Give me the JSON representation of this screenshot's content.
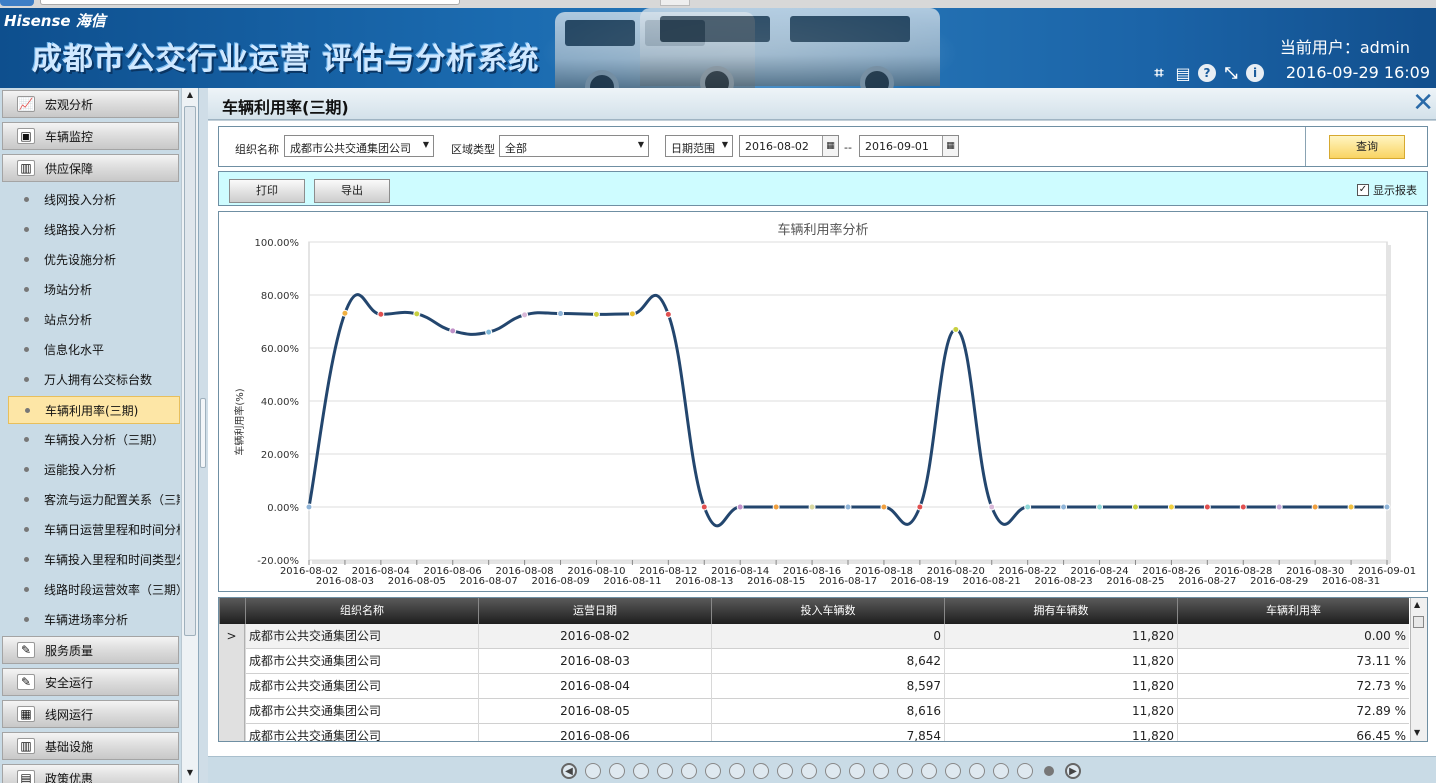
{
  "header": {
    "logo": "Hisense 海信",
    "system_name": "成都市公交行业运营 评估与分析系统",
    "current_user_label": "当前用户：admin",
    "datetime": "2016-09-29 16:09",
    "icons": [
      "crop-icon",
      "screen-icon",
      "help-icon",
      "restore-icon",
      "info-icon"
    ]
  },
  "sidebar": {
    "groups_top": [
      {
        "label": "宏观分析",
        "icon": "chart-icon"
      },
      {
        "label": "车辆监控",
        "icon": "monitor-icon"
      },
      {
        "label": "供应保障",
        "icon": "supply-icon"
      }
    ],
    "items": [
      "线网投入分析",
      "线路投入分析",
      "优先设施分析",
      "场站分析",
      "站点分析",
      "信息化水平",
      "万人拥有公交标台数",
      "车辆利用率(三期)",
      "车辆投入分析（三期）",
      "运能投入分析",
      "客流与运力配置关系（三期）",
      "车辆日运营里程和时间分析",
      "车辆投入里程和时间类型分析",
      "线路时段运营效率（三期）",
      "车辆进场率分析"
    ],
    "active_index": 7,
    "groups_bottom": [
      {
        "label": "服务质量",
        "icon": "quality-icon"
      },
      {
        "label": "安全运行",
        "icon": "safety-icon"
      },
      {
        "label": "线网运行",
        "icon": "network-icon"
      },
      {
        "label": "基础设施",
        "icon": "infrastructure-icon"
      },
      {
        "label": "政策优惠",
        "icon": "policy-icon"
      }
    ]
  },
  "page": {
    "title": "车辆利用率(三期)",
    "close_glyph": "✕"
  },
  "query": {
    "org_label": "组织名称",
    "org_value": "成都市公共交通集团公司",
    "area_label": "区域类型",
    "area_value": "全部",
    "date_mode": "日期范围",
    "date_from": "2016-08-02",
    "date_sep": "--",
    "date_to": "2016-09-01",
    "query_button": "查询"
  },
  "toolbar": {
    "print_button": "打印",
    "export_button": "导出",
    "show_report_label": "显示报表",
    "show_report_checked": true
  },
  "chart_data": {
    "type": "line",
    "title": "车辆利用率分析",
    "ylabel": "车辆利用率(%)",
    "ylim": [
      -20,
      100
    ],
    "yticks": [
      "-20.00%",
      "0.00%",
      "20.00%",
      "40.00%",
      "60.00%",
      "80.00%",
      "100.00%"
    ],
    "x": [
      "2016-08-02",
      "2016-08-03",
      "2016-08-04",
      "2016-08-05",
      "2016-08-06",
      "2016-08-07",
      "2016-08-08",
      "2016-08-09",
      "2016-08-10",
      "2016-08-11",
      "2016-08-12",
      "2016-08-13",
      "2016-08-14",
      "2016-08-15",
      "2016-08-16",
      "2016-08-17",
      "2016-08-18",
      "2016-08-19",
      "2016-08-20",
      "2016-08-21",
      "2016-08-22",
      "2016-08-23",
      "2016-08-24",
      "2016-08-25",
      "2016-08-26",
      "2016-08-27",
      "2016-08-28",
      "2016-08-29",
      "2016-08-30",
      "2016-08-31",
      "2016-09-01"
    ],
    "values": [
      0,
      73.11,
      72.73,
      72.89,
      66.45,
      66,
      72.5,
      73,
      72.7,
      72.9,
      72.7,
      0,
      0,
      0,
      0,
      0,
      0,
      0,
      67,
      0,
      0,
      0,
      0,
      0,
      0,
      0,
      0,
      0,
      0,
      0,
      0
    ],
    "point_colors": [
      "#8fb4d8",
      "#f0b040",
      "#e05050",
      "#c8d040",
      "#c090c8",
      "#7fb8d8",
      "#d8b8d8",
      "#8fb4d8",
      "#d0d040",
      "#e8c030",
      "#e05050",
      "#e05050",
      "#c090c8",
      "#f0a040",
      "#d8d8a0",
      "#8fb4d8",
      "#f0a040",
      "#e05050",
      "#c8d040",
      "#d8b8d8",
      "#8fd8d8",
      "#8fb4d8",
      "#8fd8d8",
      "#c8d040",
      "#f0d040",
      "#e05050",
      "#e05050",
      "#c8a8d8",
      "#f0a040",
      "#f0c040",
      "#8fb4d8"
    ],
    "line_color": "#23466e",
    "grid": true
  },
  "table": {
    "columns": [
      "组织名称",
      "运营日期",
      "投入车辆数",
      "拥有车辆数",
      "车辆利用率"
    ],
    "rows": [
      [
        "成都市公共交通集团公司",
        "2016-08-02",
        "0",
        "11,820",
        "0.00 %"
      ],
      [
        "成都市公共交通集团公司",
        "2016-08-03",
        "8,642",
        "11,820",
        "73.11 %"
      ],
      [
        "成都市公共交通集团公司",
        "2016-08-04",
        "8,597",
        "11,820",
        "72.73 %"
      ],
      [
        "成都市公共交通集团公司",
        "2016-08-05",
        "8,616",
        "11,820",
        "72.89 %"
      ],
      [
        "成都市公共交通集团公司",
        "2016-08-06",
        "7,854",
        "11,820",
        "66.45 %"
      ]
    ],
    "selected_row": 0,
    "row_marker": ">"
  },
  "pager": {
    "page_count": 20,
    "current_page": 20
  }
}
